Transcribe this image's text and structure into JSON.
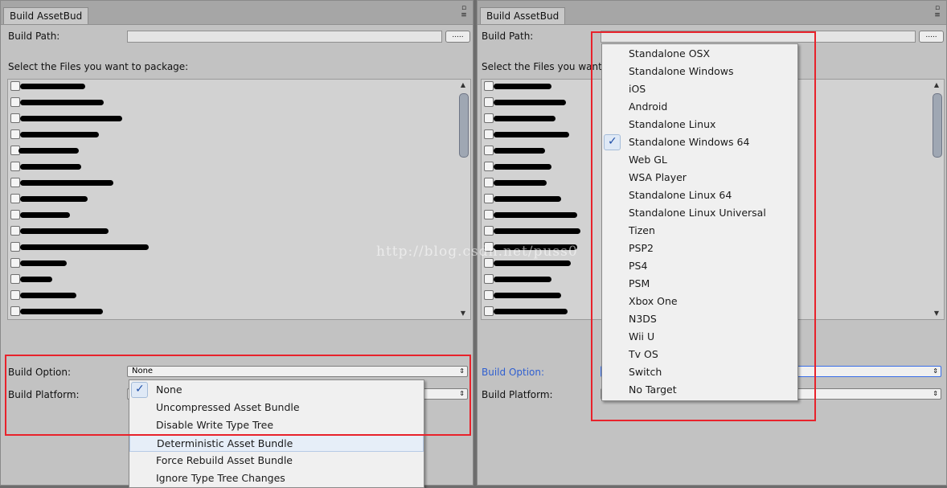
{
  "window": {
    "tab_title": "Build AssetBud",
    "pin_glyph": "▫",
    "menu_glyph": "≡"
  },
  "labels": {
    "build_path": "Build Path:",
    "select_files": "Select the Files you want to package:",
    "select_files_truncated": "Select the Files you want t",
    "build_option": "Build Option:",
    "build_platform": "Build Platform:",
    "browse_button": "....."
  },
  "build_option_value": "None",
  "build_option_menu": {
    "items": [
      "None",
      "Uncompressed Asset Bundle",
      "Disable Write Type Tree",
      "Deterministic Asset Bundle",
      "Force Rebuild Asset Bundle",
      "Ignore Type Tree Changes"
    ],
    "checked": "None",
    "highlighted": "Deterministic Asset Bundle"
  },
  "platform_menu": {
    "items": [
      "Standalone OSX",
      "Standalone Windows",
      "iOS",
      "Android",
      "Standalone Linux",
      "Standalone Windows 64",
      "Web GL",
      "WSA Player",
      "Standalone Linux 64",
      "Standalone Linux Universal",
      "Tizen",
      "PSP2",
      "PS4",
      "PSM",
      "Xbox One",
      "N3DS",
      "Wii U",
      "Tv OS",
      "Switch",
      "No Target"
    ],
    "checked": "Standalone Windows 64"
  },
  "watermark": "http://blog.csdn.net/puss0",
  "colors": {
    "annotation_red": "#e8222b",
    "focus_blue": "#2f5fd0",
    "panel_bg": "#c2c2c2"
  },
  "icons": {
    "check": "✓",
    "dropdown_arrow": "⇕",
    "scroll_up": "▲",
    "scroll_down": "▼"
  }
}
